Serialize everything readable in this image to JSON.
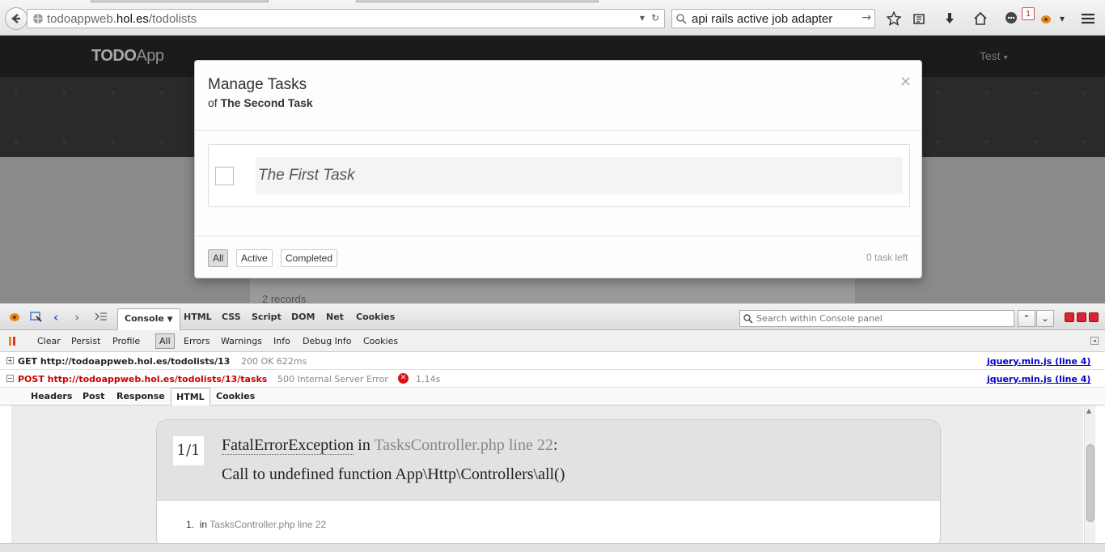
{
  "browser": {
    "url_prefix": "todoappweb.",
    "url_host": "hol.es",
    "url_path": "/todolists",
    "search_query": "api rails active job adapter",
    "notification_count": "1"
  },
  "app": {
    "brand_bold": "TODO",
    "brand_rest": "App",
    "user_menu": "Test",
    "records_text": "2 records"
  },
  "modal": {
    "title": "Manage Tasks",
    "subtitle_prefix": "of",
    "subtitle_name": "The Second Task",
    "close_label": "×",
    "tasks": [
      {
        "label": "The First Task",
        "completed": false
      }
    ],
    "filters": {
      "all": "All",
      "active": "Active",
      "completed": "Completed"
    },
    "tasks_left": "0 task left"
  },
  "firebug": {
    "tabs": {
      "console": "Console",
      "html": "HTML",
      "css": "CSS",
      "script": "Script",
      "dom": "DOM",
      "net": "Net",
      "cookies": "Cookies"
    },
    "search_placeholder": "Search within Console panel",
    "filters": {
      "clear": "Clear",
      "persist": "Persist",
      "profile": "Profile",
      "all": "All",
      "errors": "Errors",
      "warnings": "Warnings",
      "info": "Info",
      "debug_info": "Debug Info",
      "cookies": "Cookies"
    },
    "requests": [
      {
        "method": "GET http://todoappweb.hol.es/todolists/13",
        "status": "200 OK 622ms",
        "source": "jquery.min.js (line 4)",
        "error": false
      },
      {
        "method": "POST http://todoappweb.hol.es/todolists/13/tasks",
        "status": "500 Internal Server Error",
        "time": "1,14s",
        "source": "jquery.min.js (line 4)",
        "error": true
      }
    ],
    "subtabs": {
      "headers": "Headers",
      "post": "Post",
      "response": "Response",
      "html": "HTML",
      "cookies": "Cookies"
    },
    "exception": {
      "count": "1/1",
      "class": "FatalErrorException",
      "in_word": "in",
      "location": "TasksController.php line 22",
      "colon": ":",
      "message": "Call to undefined function App\\Http\\Controllers\\all()",
      "trace_index": "1.",
      "trace_in": "in",
      "trace_location": "TasksController.php line 22"
    }
  },
  "colors": {
    "error": "#cc0000",
    "link": "#0000cc",
    "navbar": "#1b1b1b"
  }
}
